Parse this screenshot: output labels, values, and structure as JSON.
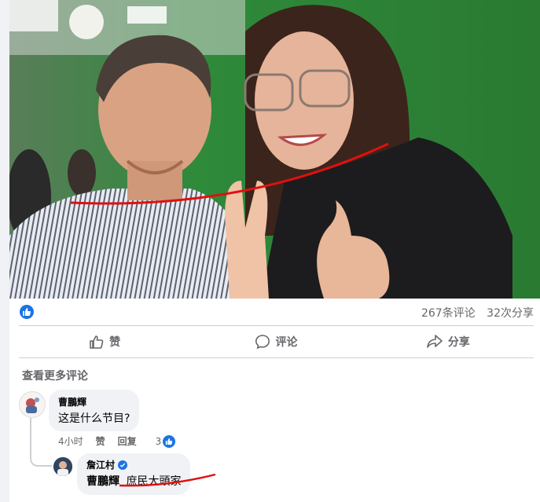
{
  "post": {
    "stats": {
      "comments": "267条评论",
      "shares": "32次分享"
    },
    "actions": {
      "like": "赞",
      "comment": "评论",
      "share": "分享"
    },
    "view_more_comments": "查看更多评论"
  },
  "comments": [
    {
      "author": "曹鵬輝",
      "text": "这是什么节目?",
      "time": "4小时",
      "like_label": "赞",
      "reply_label": "回复",
      "reaction_count": "3"
    }
  ],
  "replies": [
    {
      "author": "詹江村",
      "verified": true,
      "mention": "曹鵬輝",
      "text": "庶民大頭家"
    }
  ],
  "colors": {
    "accent": "#1b74e4",
    "annotation_red": "#e01010",
    "green_screen": "#2f8a3a"
  }
}
